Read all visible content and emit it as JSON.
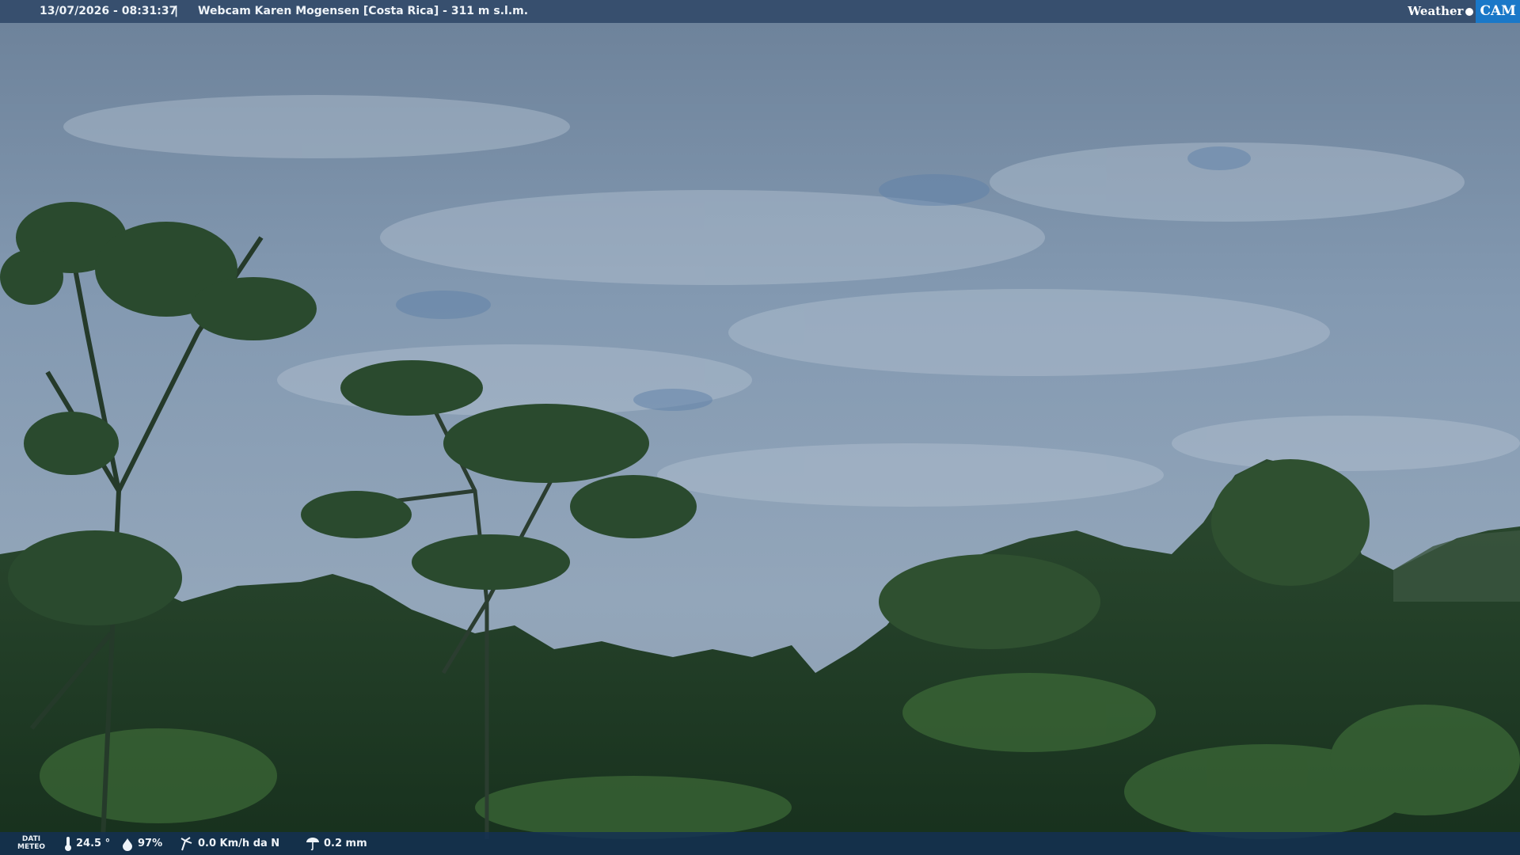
{
  "overlay": {
    "datetime": "13/07/2026 - 08:31:37",
    "separator": "|",
    "title": "Webcam Karen Mogensen [Costa Rica] - 311 m s.l.m.",
    "logo": {
      "weather": "Weather",
      "cam": "CAM"
    }
  },
  "weather": {
    "label_line1": "DATI",
    "label_line2": "METEO",
    "temperature": "24.5 °",
    "humidity": "97%",
    "wind": "0.0 Km/h da N",
    "rain": "0.2 mm"
  },
  "icons": [
    "thermometer-icon",
    "humidity-icon",
    "wind-icon",
    "rain-icon"
  ],
  "colors": {
    "sky": "#7d93ab",
    "forest": "#1f3a26",
    "bar": "#304868",
    "accent": "#1a78c8"
  }
}
